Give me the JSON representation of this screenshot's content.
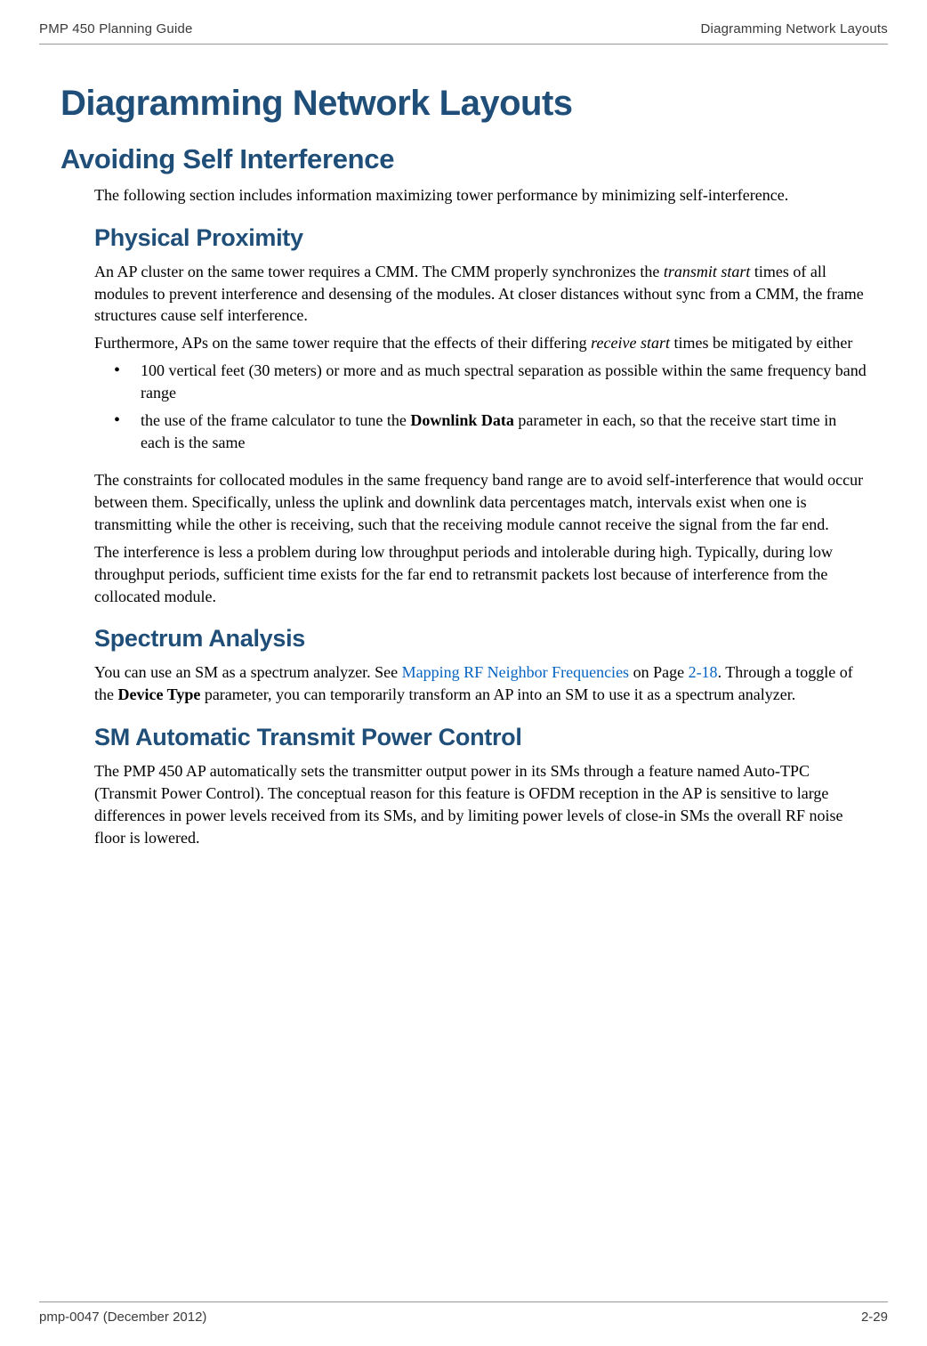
{
  "header": {
    "left": "PMP 450 Planning Guide",
    "right": "Diagramming Network Layouts"
  },
  "h1": "Diagramming Network Layouts",
  "h2": "Avoiding Self Interference",
  "intro": "The following section includes information maximizing tower performance by minimizing self-interference.",
  "h3_1": "Physical Proximity",
  "p1_pre": "An AP cluster on the same tower requires a CMM. The CMM properly synchronizes the ",
  "p1_em": "transmit start",
  "p1_post": " times of all modules to prevent interference and desensing of the modules. At closer distances without sync from a CMM, the frame structures cause self interference.",
  "p2_pre": "Furthermore, APs on the same tower require that the effects of their differing ",
  "p2_em": "receive start",
  "p2_post": " times be mitigated by either",
  "li1": "100 vertical feet (30 meters) or more and as much spectral separation as possible within the same frequency band range",
  "li2_pre": "the use of the frame calculator to tune the ",
  "li2_bold": "Downlink Data",
  "li2_post": " parameter in each, so that the receive start time in each is the same",
  "p3": "The constraints for collocated modules in the same frequency band range are to avoid self-interference that would occur between them. Specifically, unless the uplink and downlink data percentages match, intervals exist when one is transmitting while the other is receiving, such that the receiving module cannot receive the signal from the far end.",
  "p4": "The interference is less a problem during low throughput periods and intolerable during high. Typically, during low throughput periods, sufficient time exists for the far end to retransmit packets lost because of interference from the collocated module.",
  "h3_2": "Spectrum Analysis",
  "p5_pre": "You can use an SM as a spectrum analyzer. See ",
  "p5_link": "Mapping RF Neighbor Frequencies",
  "p5_mid": " on Page ",
  "p5_page": "2-18",
  "p5_post1": ". Through a toggle of the ",
  "p5_bold": "Device Type",
  "p5_post2": " parameter, you can temporarily transform an AP into an SM to use it as a spectrum analyzer.",
  "h3_3": "SM Automatic Transmit Power Control",
  "p6": "The PMP 450 AP automatically sets the transmitter output power in its SMs through a feature named Auto-TPC (Transmit Power Control). The conceptual reason for this feature is OFDM reception in the AP is sensitive to large differences in power levels received from its SMs, and by limiting power levels of close-in SMs the overall RF noise floor is lowered.",
  "footer": {
    "left": "pmp-0047 (December 2012)",
    "right": "2-29"
  }
}
